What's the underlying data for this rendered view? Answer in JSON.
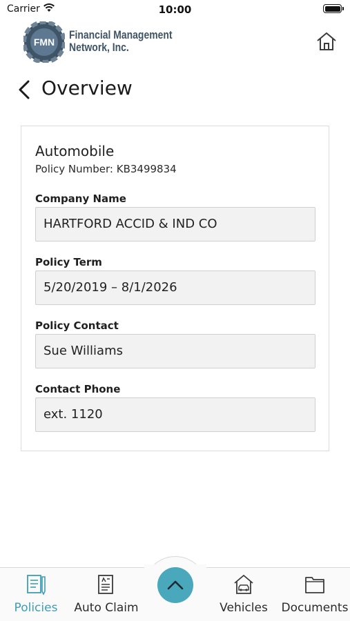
{
  "status_bar": {
    "carrier": "Carrier",
    "time": "10:00"
  },
  "header": {
    "brand_line1": "Financial Management",
    "brand_line2": "Network, Inc.",
    "logo_text": "FMN"
  },
  "title": "Overview",
  "policy": {
    "type": "Automobile",
    "number": "Policy Number: KB3499834",
    "fields": [
      {
        "label": "Company Name",
        "value": "HARTFORD ACCID & IND CO"
      },
      {
        "label": "Policy Term",
        "value": "5/20/2019 – 8/1/2026"
      },
      {
        "label": "Policy Contact",
        "value": "Sue Williams"
      },
      {
        "label": "Contact Phone",
        "value": "ext. 1120"
      }
    ]
  },
  "tabs": [
    {
      "label": "Policies",
      "icon": "policies-icon",
      "active": true
    },
    {
      "label": "Auto Claim",
      "icon": "auto-claim-icon",
      "active": false
    },
    {
      "label": "Vehicles",
      "icon": "vehicles-icon",
      "active": false
    },
    {
      "label": "Documents",
      "icon": "documents-icon",
      "active": false
    }
  ],
  "colors": {
    "accent": "#4aa8bc",
    "active_tab": "#3e9db5",
    "brand": "#3f5466"
  }
}
